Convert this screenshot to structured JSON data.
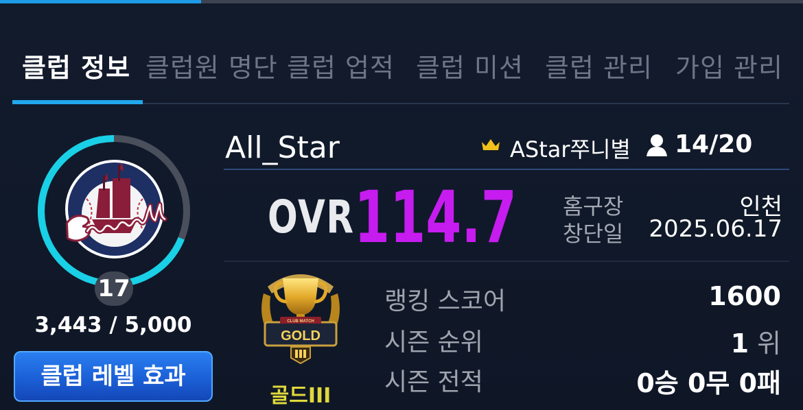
{
  "top_progress": 0.25,
  "tabs": [
    {
      "label": "클럽 정보",
      "active": true
    },
    {
      "label": "클럽원 명단",
      "active": false
    },
    {
      "label": "클럽 업적",
      "active": false
    },
    {
      "label": "클럽 미션",
      "active": false
    },
    {
      "label": "클럽 관리",
      "active": false
    },
    {
      "label": "가입 관리",
      "active": false
    }
  ],
  "club": {
    "name": "All_Star",
    "leader": "AStar쭈니별",
    "members": "14/20",
    "ovr_label": "OVR",
    "ovr": "114.7",
    "home_label": "홈구장",
    "home": "인천",
    "founded_label": "창단일",
    "founded": "2025.06.17",
    "logo_text": "Baseball"
  },
  "level": {
    "value": "17",
    "exp_text": "3,443 / 5,000",
    "exp_fraction": 0.6886,
    "button_label": "클럽 레벨 효과"
  },
  "tier": {
    "name": "골드III",
    "badge_small_text": "CLUB MATCH",
    "badge_text": "GOLD"
  },
  "stats": {
    "ranking_label": "랭킹 스코어",
    "ranking": "1600",
    "season_rank_label": "시즌 순위",
    "season_rank": "1",
    "season_rank_unit": "위",
    "season_record_label": "시즌 전적",
    "season_record": "0승 0무 0패"
  },
  "colors": {
    "accent": "#22a8ee",
    "ovr": "#c61cf0",
    "tier": "#e0d93a",
    "ring": "#19d0e6"
  }
}
